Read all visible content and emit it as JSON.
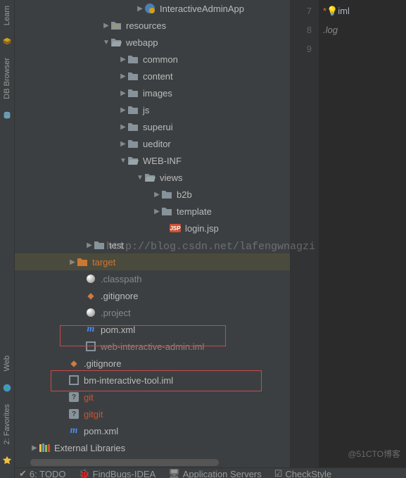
{
  "leftRail": {
    "learn": "Learn",
    "dbBrowser": "DB Browser",
    "web": "Web",
    "favorites": "2: Favorites"
  },
  "tree": {
    "interactiveAdminApp": "InteractiveAdminApp",
    "resources": "resources",
    "webapp": "webapp",
    "common": "common",
    "content": "content",
    "images": "images",
    "js": "js",
    "superui": "superui",
    "ueditor": "ueditor",
    "webinf": "WEB-INF",
    "views": "views",
    "b2b": "b2b",
    "template": "template",
    "loginjsp": "login.jsp",
    "test": "test",
    "target": "target",
    "classpath": ".classpath",
    "gitignore1": ".gitignore",
    "project": ".project",
    "pomxml1": "pom.xml",
    "webinteractiveadmin": "web-interactive-admin.iml",
    "gitignore2": ".gitignore",
    "bminteractivetool": "bm-interactive-tool.iml",
    "git": "git",
    "gitgit": "gitgit",
    "pomxml2": "pom.xml",
    "externalLibraries": "External Libraries"
  },
  "editor": {
    "lines": [
      "7",
      "8",
      "9"
    ],
    "code": {
      "l1_prefix": "*",
      "l1_text": "iml",
      "l2": ".log"
    }
  },
  "bottomBar": {
    "todo": "6: TODO",
    "findbugs": "FindBugs-IDEA",
    "appservers": "Application Servers",
    "checkstyle": "CheckStyle"
  },
  "jspLabel": "JSP",
  "watermark": "http://blog.csdn.net/lafengwnagzi",
  "watermark2": "@51CTO博客"
}
